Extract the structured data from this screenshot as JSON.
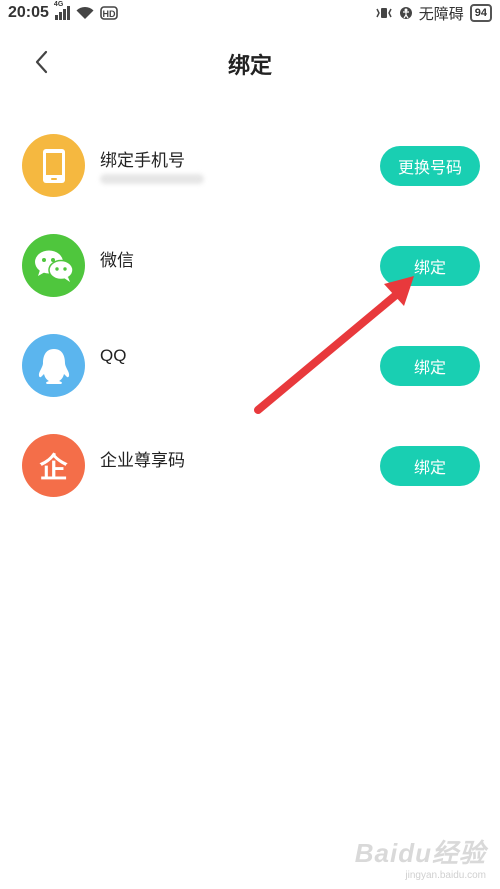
{
  "status_bar": {
    "time": "20:05",
    "network": "4G",
    "accessibility": "无障碍",
    "battery": "94"
  },
  "nav": {
    "title": "绑定"
  },
  "rows": [
    {
      "label": "绑定手机号",
      "action": "更换号码",
      "icon": "phone-icon",
      "color": "#f5b840"
    },
    {
      "label": "微信",
      "action": "绑定",
      "icon": "wechat-icon",
      "color": "#4fc63d"
    },
    {
      "label": "QQ",
      "action": "绑定",
      "icon": "qq-icon",
      "color": "#5bb5ee"
    },
    {
      "label": "企业尊享码",
      "action": "绑定",
      "icon": "enterprise-icon",
      "color": "#f46e49",
      "icon_char": "企"
    }
  ],
  "watermark": {
    "main": "Baidu经验",
    "sub": "jingyan.baidu.com"
  },
  "colors": {
    "button": "#19cfb2",
    "arrow": "#e8393c"
  }
}
